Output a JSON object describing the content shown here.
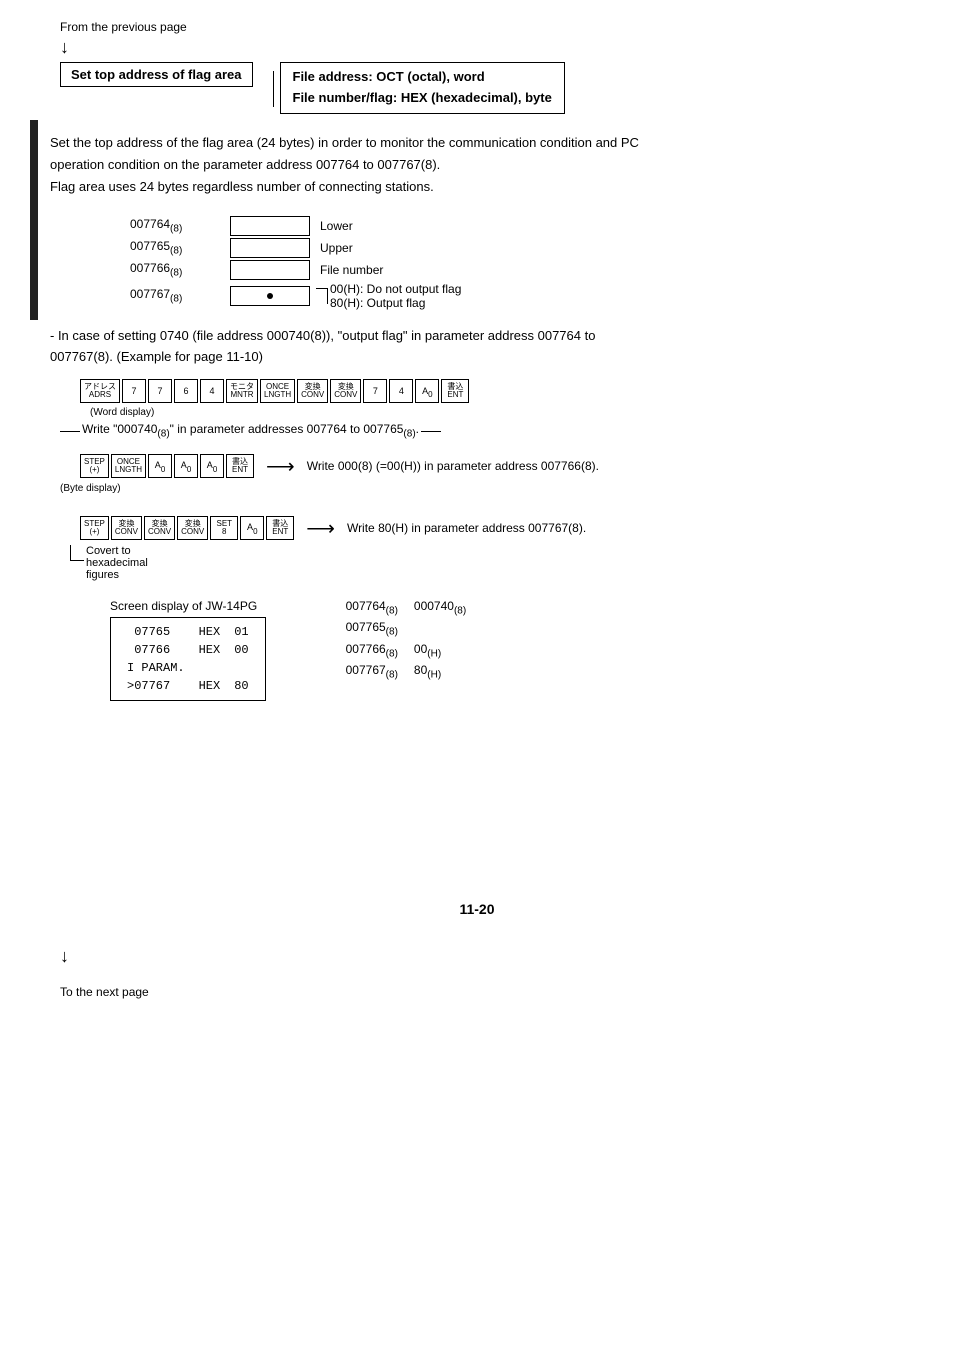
{
  "page": {
    "from_prev": "From the previous page",
    "to_next": "To the next page",
    "page_num": "11-20"
  },
  "header": {
    "flag_box": "Set top address of flag area",
    "file_addr_line1": "File address: OCT (octal), word",
    "file_addr_line2": "File number/flag: HEX (hexadecimal), byte"
  },
  "description": {
    "line1": "Set the top address of the flag area (24 bytes) in order to monitor the communication condition and PC",
    "line2": "operation condition on the parameter address 007764 to 007767(8).",
    "line3": "Flag area uses 24 bytes regardless number of connecting stations."
  },
  "address_table": [
    {
      "addr": "007764(8)",
      "label": "Lower"
    },
    {
      "addr": "007765(8)",
      "label": "Upper"
    },
    {
      "addr": "007766(8)",
      "label": "File number"
    },
    {
      "addr": "007767(8)",
      "label": ""
    }
  ],
  "flag_notes": {
    "note1": "00(H): Do not output flag",
    "note2": "80(H): Output flag"
  },
  "example_text": {
    "line1": "- In case of setting   0740 (file address 000740(8)), \"output flag\" in parameter address 007764 to",
    "line2": "007767(8). (Example for page 11-10)"
  },
  "word_display": {
    "label": "(Word display)",
    "keys": [
      "アドレス\nADRS",
      "7",
      "7",
      "6",
      "4",
      "モニタ\nMNTR",
      "ONCE\nLNGTH",
      "変換\nCONV",
      "変換\nCONV",
      "7",
      "4",
      "A\n0",
      "書込\nENT"
    ],
    "note": "Write \"000740(8)\" in parameter addresses 007764 to 007765(8)."
  },
  "byte_display": {
    "label": "(Byte display)",
    "keys": [
      "STEP\n(+)",
      "ONCE\nLNGTH",
      "A\n0",
      "A\n0",
      "A\n0",
      "書込\nENT"
    ],
    "arrow_text": "Write 000(8) (=00(H)) in parameter address 007766(8)."
  },
  "hex_display": {
    "keys": [
      "STEP\n(+)",
      "変換\nCONV",
      "変換\nCONV",
      "変換\nCONV",
      "SET\n8",
      "A\n0",
      "書込\nENT"
    ],
    "arrow_text": "Write 80(H) in parameter address 007767(8).",
    "convert_note": "Covert to\nhexadecimal\nfigures"
  },
  "screen_display": {
    "title": "Screen display of JW-14PG",
    "rows": [
      {
        "col1": " 07765",
        "col2": "HEX",
        "col3": "01"
      },
      {
        "col1": " 07766",
        "col2": "HEX",
        "col3": "00"
      },
      {
        "col1": "I PARAM.",
        "col2": "",
        "col3": ""
      },
      {
        "col1": ">07767",
        "col2": "HEX",
        "col3": "80"
      }
    ]
  },
  "right_table": {
    "rows": [
      {
        "addr": "007764(8)",
        "val": "000740(8)"
      },
      {
        "addr": "007765(8)",
        "val": ""
      },
      {
        "addr": "007766(8)",
        "val": "00(H)"
      },
      {
        "addr": "007767(8)",
        "val": "80(H)"
      }
    ]
  }
}
